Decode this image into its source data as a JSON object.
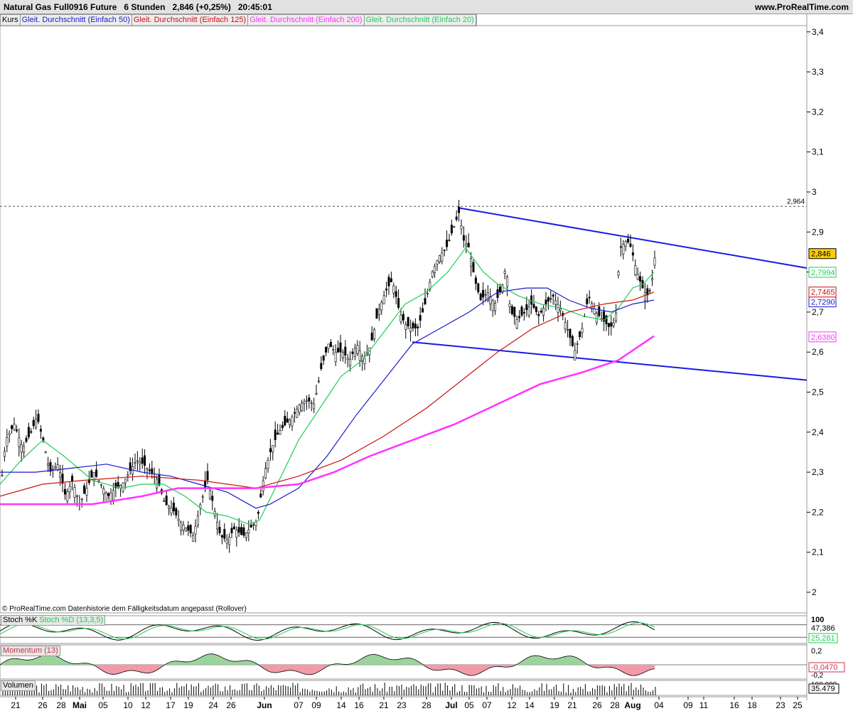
{
  "header": {
    "instrument": "Natural Gas Full0916 Future",
    "timeframe": "6 Stunden",
    "last_price": "2,846 (+0,25%)",
    "time": "20:45:01",
    "brand": "www.ProRealTime.com"
  },
  "legend": [
    {
      "label": "Kurs",
      "color": "#000000"
    },
    {
      "label": "Gleit. Durchschnitt (Einfach 50)",
      "color": "#1a1acc"
    },
    {
      "label": "Gleit. Durchschnitt (Einfach 125)",
      "color": "#cc1111"
    },
    {
      "label": "Gleit. Durchschnitt (Einfach 200)",
      "color": "#ff33ff"
    },
    {
      "label": "Gleit. Durchschnitt (Einfach 20)",
      "color": "#22cc55"
    }
  ],
  "credit": "© ProRealTime.com  Datenhistorie dem Fälligkeitsdatum angepasst (Rollover)",
  "chart_data": {
    "type": "candlestick",
    "yaxis_ticks": [
      "3,4",
      "3,3",
      "3,2",
      "3,1",
      "3",
      "2,9",
      "2,8",
      "2,7",
      "2,6",
      "2,5",
      "2,4",
      "2,3",
      "2,2",
      "2,1",
      "2"
    ],
    "ylim": [
      2.0,
      3.45
    ],
    "xaxis_ticks": [
      {
        "label": "21",
        "bold": false
      },
      {
        "label": "26",
        "bold": false
      },
      {
        "label": "28",
        "bold": false
      },
      {
        "label": "Mai",
        "bold": true
      },
      {
        "label": "05",
        "bold": false
      },
      {
        "label": "10",
        "bold": false
      },
      {
        "label": "12",
        "bold": false
      },
      {
        "label": "17",
        "bold": false
      },
      {
        "label": "19",
        "bold": false
      },
      {
        "label": "24",
        "bold": false
      },
      {
        "label": "26",
        "bold": false
      },
      {
        "label": "Jun",
        "bold": true
      },
      {
        "label": "07",
        "bold": false
      },
      {
        "label": "09",
        "bold": false
      },
      {
        "label": "14",
        "bold": false
      },
      {
        "label": "16",
        "bold": false
      },
      {
        "label": "21",
        "bold": false
      },
      {
        "label": "23",
        "bold": false
      },
      {
        "label": "28",
        "bold": false
      },
      {
        "label": "Jul",
        "bold": true
      },
      {
        "label": "05",
        "bold": false
      },
      {
        "label": "07",
        "bold": false
      },
      {
        "label": "12",
        "bold": false
      },
      {
        "label": "14",
        "bold": false
      },
      {
        "label": "19",
        "bold": false
      },
      {
        "label": "21",
        "bold": false
      },
      {
        "label": "26",
        "bold": false
      },
      {
        "label": "28",
        "bold": false
      },
      {
        "label": "Aug",
        "bold": true
      },
      {
        "label": "04",
        "bold": false
      },
      {
        "label": "09",
        "bold": false
      },
      {
        "label": "11",
        "bold": false
      },
      {
        "label": "16",
        "bold": false
      },
      {
        "label": "18",
        "bold": false
      },
      {
        "label": "23",
        "bold": false
      },
      {
        "label": "25",
        "bold": false
      }
    ],
    "price_path": [
      [
        0,
        2.24
      ],
      [
        8,
        2.38
      ],
      [
        20,
        2.42
      ],
      [
        32,
        2.36
      ],
      [
        44,
        2.4
      ],
      [
        52,
        2.44
      ],
      [
        62,
        2.37
      ],
      [
        70,
        2.3
      ],
      [
        82,
        2.32
      ],
      [
        92,
        2.24
      ],
      [
        102,
        2.28
      ],
      [
        112,
        2.22
      ],
      [
        122,
        2.26
      ],
      [
        132,
        2.3
      ],
      [
        142,
        2.27
      ],
      [
        152,
        2.24
      ],
      [
        162,
        2.26
      ],
      [
        172,
        2.27
      ],
      [
        182,
        2.3
      ],
      [
        192,
        2.33
      ],
      [
        202,
        2.32
      ],
      [
        212,
        2.3
      ],
      [
        222,
        2.28
      ],
      [
        232,
        2.22
      ],
      [
        242,
        2.21
      ],
      [
        252,
        2.18
      ],
      [
        262,
        2.16
      ],
      [
        272,
        2.14
      ],
      [
        282,
        2.22
      ],
      [
        292,
        2.28
      ],
      [
        300,
        2.22
      ],
      [
        310,
        2.14
      ],
      [
        320,
        2.13
      ],
      [
        330,
        2.16
      ],
      [
        342,
        2.14
      ],
      [
        352,
        2.16
      ],
      [
        362,
        2.18
      ],
      [
        372,
        2.3
      ],
      [
        382,
        2.36
      ],
      [
        392,
        2.4
      ],
      [
        402,
        2.42
      ],
      [
        412,
        2.44
      ],
      [
        422,
        2.47
      ],
      [
        432,
        2.48
      ],
      [
        442,
        2.47
      ],
      [
        452,
        2.56
      ],
      [
        462,
        2.62
      ],
      [
        472,
        2.6
      ],
      [
        482,
        2.6
      ],
      [
        492,
        2.58
      ],
      [
        502,
        2.62
      ],
      [
        512,
        2.58
      ],
      [
        522,
        2.62
      ],
      [
        532,
        2.7
      ],
      [
        542,
        2.75
      ],
      [
        552,
        2.78
      ],
      [
        562,
        2.7
      ],
      [
        570,
        2.67
      ],
      [
        578,
        2.66
      ],
      [
        588,
        2.66
      ],
      [
        598,
        2.72
      ],
      [
        608,
        2.8
      ],
      [
        618,
        2.84
      ],
      [
        628,
        2.86
      ],
      [
        638,
        2.91
      ],
      [
        646,
        2.95
      ],
      [
        652,
        2.88
      ],
      [
        660,
        2.86
      ],
      [
        668,
        2.78
      ],
      [
        676,
        2.73
      ],
      [
        686,
        2.75
      ],
      [
        696,
        2.72
      ],
      [
        706,
        2.76
      ],
      [
        712,
        2.82
      ],
      [
        718,
        2.7
      ],
      [
        728,
        2.68
      ],
      [
        738,
        2.7
      ],
      [
        748,
        2.72
      ],
      [
        758,
        2.69
      ],
      [
        768,
        2.72
      ],
      [
        778,
        2.74
      ],
      [
        788,
        2.71
      ],
      [
        798,
        2.66
      ],
      [
        808,
        2.6
      ],
      [
        818,
        2.65
      ],
      [
        828,
        2.74
      ],
      [
        838,
        2.7
      ],
      [
        848,
        2.68
      ],
      [
        858,
        2.66
      ],
      [
        866,
        2.68
      ],
      [
        872,
        2.86
      ],
      [
        882,
        2.88
      ],
      [
        888,
        2.86
      ],
      [
        896,
        2.8
      ],
      [
        904,
        2.76
      ],
      [
        910,
        2.74
      ],
      [
        916,
        2.76
      ],
      [
        922,
        2.85
      ]
    ],
    "series": [
      {
        "name": "Gleit. Durchschnitt (Einfach 20)",
        "color": "#22cc55",
        "value_label": "2,7994",
        "points": [
          [
            0,
            2.27
          ],
          [
            30,
            2.33
          ],
          [
            60,
            2.38
          ],
          [
            90,
            2.34
          ],
          [
            130,
            2.28
          ],
          [
            170,
            2.26
          ],
          [
            200,
            2.27
          ],
          [
            230,
            2.27
          ],
          [
            260,
            2.24
          ],
          [
            290,
            2.2
          ],
          [
            320,
            2.19
          ],
          [
            350,
            2.17
          ],
          [
            365,
            2.18
          ],
          [
            390,
            2.27
          ],
          [
            420,
            2.38
          ],
          [
            450,
            2.46
          ],
          [
            480,
            2.54
          ],
          [
            510,
            2.58
          ],
          [
            540,
            2.65
          ],
          [
            570,
            2.72
          ],
          [
            600,
            2.75
          ],
          [
            630,
            2.8
          ],
          [
            655,
            2.86
          ],
          [
            680,
            2.8
          ],
          [
            700,
            2.77
          ],
          [
            730,
            2.74
          ],
          [
            760,
            2.72
          ],
          [
            790,
            2.71
          ],
          [
            820,
            2.69
          ],
          [
            850,
            2.68
          ],
          [
            870,
            2.71
          ],
          [
            890,
            2.76
          ],
          [
            905,
            2.77
          ],
          [
            920,
            2.8
          ]
        ]
      },
      {
        "name": "Gleit. Durchschnitt (Einfach 50)",
        "color": "#1a1acc",
        "value_label": "2,7290",
        "points": [
          [
            0,
            2.3
          ],
          [
            50,
            2.3
          ],
          [
            100,
            2.31
          ],
          [
            150,
            2.32
          ],
          [
            200,
            2.3
          ],
          [
            240,
            2.29
          ],
          [
            280,
            2.27
          ],
          [
            320,
            2.25
          ],
          [
            360,
            2.21
          ],
          [
            380,
            2.22
          ],
          [
            420,
            2.26
          ],
          [
            460,
            2.34
          ],
          [
            500,
            2.44
          ],
          [
            540,
            2.53
          ],
          [
            580,
            2.62
          ],
          [
            620,
            2.66
          ],
          [
            660,
            2.7
          ],
          [
            700,
            2.75
          ],
          [
            740,
            2.76
          ],
          [
            770,
            2.76
          ],
          [
            800,
            2.73
          ],
          [
            830,
            2.71
          ],
          [
            860,
            2.7
          ],
          [
            890,
            2.72
          ],
          [
            920,
            2.73
          ]
        ]
      },
      {
        "name": "Gleit. Durchschnitt (Einfach 125)",
        "color": "#cc1111",
        "value_label": "2,7465",
        "points": [
          [
            0,
            2.24
          ],
          [
            60,
            2.27
          ],
          [
            120,
            2.28
          ],
          [
            200,
            2.29
          ],
          [
            280,
            2.28
          ],
          [
            360,
            2.26
          ],
          [
            420,
            2.29
          ],
          [
            480,
            2.33
          ],
          [
            540,
            2.39
          ],
          [
            600,
            2.46
          ],
          [
            650,
            2.53
          ],
          [
            700,
            2.6
          ],
          [
            750,
            2.66
          ],
          [
            800,
            2.7
          ],
          [
            850,
            2.72
          ],
          [
            890,
            2.73
          ],
          [
            920,
            2.75
          ]
        ]
      },
      {
        "name": "Gleit. Durchschnitt (Einfach 200)",
        "color": "#ff33ff",
        "value_label": "2,6380",
        "points": [
          [
            0,
            2.22
          ],
          [
            60,
            2.22
          ],
          [
            130,
            2.22
          ],
          [
            200,
            2.24
          ],
          [
            250,
            2.26
          ],
          [
            300,
            2.26
          ],
          [
            360,
            2.26
          ],
          [
            420,
            2.27
          ],
          [
            470,
            2.3
          ],
          [
            520,
            2.34
          ],
          [
            580,
            2.38
          ],
          [
            640,
            2.42
          ],
          [
            700,
            2.47
          ],
          [
            760,
            2.52
          ],
          [
            820,
            2.55
          ],
          [
            870,
            2.58
          ],
          [
            920,
            2.64
          ]
        ]
      }
    ],
    "trendlines": [
      {
        "color": "#1a1ae6",
        "from": [
          646,
          2.96
        ],
        "to": [
          1135,
          2.81
        ]
      },
      {
        "color": "#1a1ae6",
        "from": [
          580,
          2.625
        ],
        "to": [
          1135,
          2.53
        ]
      }
    ],
    "annotations": {
      "horizontal_level": 2.964,
      "horizontal_label": "2,964",
      "last_price_label": "2,846",
      "last_price_value": 2.846
    }
  },
  "stochastic": {
    "label_k": "Stoch %K",
    "label_d": "Stoch %D (13,3,5)",
    "axis_top": "100",
    "value_k": "47,386",
    "value_d": "25,281"
  },
  "momentum": {
    "label": "Momentum (13)",
    "axis_top": "0,2",
    "axis_bottom": "-0,2",
    "value": "-0,0470"
  },
  "volume": {
    "label": "Volumen",
    "axis_top": "100.000",
    "value": "35.479"
  }
}
